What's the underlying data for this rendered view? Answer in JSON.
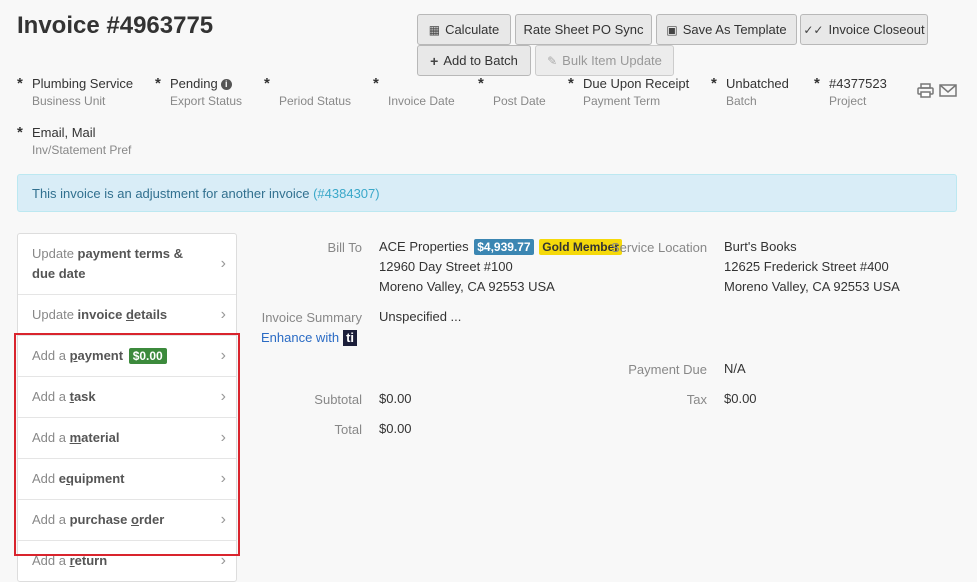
{
  "page": {
    "title": "Invoice #4963775"
  },
  "toolbar": {
    "calculate": "Calculate",
    "rate_sheet": "Rate Sheet PO Sync",
    "save_template": "Save As Template",
    "closeout": "Invoice Closeout",
    "add_batch": "Add to Batch",
    "bulk_update": "Bulk Item Update"
  },
  "fields": {
    "business_unit": {
      "value": "Plumbing Service",
      "label": "Business Unit"
    },
    "export_status": {
      "value": "Pending",
      "label": "Export Status"
    },
    "period_status": {
      "value": "",
      "label": "Period Status"
    },
    "invoice_date": {
      "value": "",
      "label": "Invoice Date"
    },
    "post_date": {
      "value": "",
      "label": "Post Date"
    },
    "payment_term": {
      "value": "Due Upon Receipt",
      "label": "Payment Term"
    },
    "batch": {
      "value": "Unbatched",
      "label": "Batch"
    },
    "project": {
      "value": "#4377523",
      "label": "Project"
    },
    "inv_pref": {
      "value": "Email, Mail",
      "label": "Inv/Statement Pref"
    }
  },
  "alert": {
    "text": "This invoice is an adjustment for another invoice ",
    "link": "(#4384307)"
  },
  "menu": {
    "update_terms": {
      "prefix": "Update ",
      "bold": "payment terms & due date"
    },
    "update_details": {
      "prefix": "Update ",
      "bold_a": "invoice ",
      "bold_u": "d",
      "bold_b": "etails"
    },
    "add_payment": {
      "prefix": "Add a ",
      "u": "p",
      "bold": "ayment",
      "badge": "$0.00"
    },
    "add_task": {
      "prefix": "Add a ",
      "u": "t",
      "bold": "ask"
    },
    "add_material": {
      "prefix": "Add a ",
      "u": "m",
      "bold": "aterial"
    },
    "add_equipment": {
      "prefix": "Add ",
      "bold_a": "e",
      "u": "q",
      "bold_b": "uipment"
    },
    "add_po": {
      "prefix": "Add a ",
      "bold_a": "purchase ",
      "u": "o",
      "bold_b": "rder"
    },
    "add_return": {
      "prefix": "Add a ",
      "u": "r",
      "bold": "eturn"
    }
  },
  "details": {
    "bill_to_label": "Bill To",
    "bill_to_name": "ACE Properties",
    "balance_badge": "$4,939.77",
    "member_badge": "Gold Member",
    "bill_to_line1": "12960 Day Street #100",
    "bill_to_line2": "Moreno Valley, CA 92553 USA",
    "service_location_label": "Service Location",
    "service_name": "Burt's Books",
    "service_line1": "12625 Frederick Street #400",
    "service_line2": "Moreno Valley, CA 92553 USA",
    "summary_label": "Invoice Summary",
    "summary_value": "Unspecified ...",
    "enhance_label": "Enhance with",
    "enhance_logo": "ti",
    "payment_due_label": "Payment Due",
    "payment_due_value": "N/A",
    "subtotal_label": "Subtotal",
    "subtotal_value": "$0.00",
    "tax_label": "Tax",
    "tax_value": "$0.00",
    "total_label": "Total",
    "total_value": "$0.00"
  },
  "icons": {
    "calculator": "calculator-icon",
    "save": "floppy-icon",
    "check": "double-check-icon",
    "plus": "plus-icon",
    "pencil": "pencil-icon",
    "print": "print-icon",
    "mail": "envelope-icon",
    "chevron": "chevron-right-icon"
  },
  "colors": {
    "highlight_border": "#d9242d",
    "alert_bg": "#d9edf7",
    "payment_badge": "#3c8a3c",
    "balance_badge": "#3b86b2",
    "member_badge": "#f5d90a"
  }
}
